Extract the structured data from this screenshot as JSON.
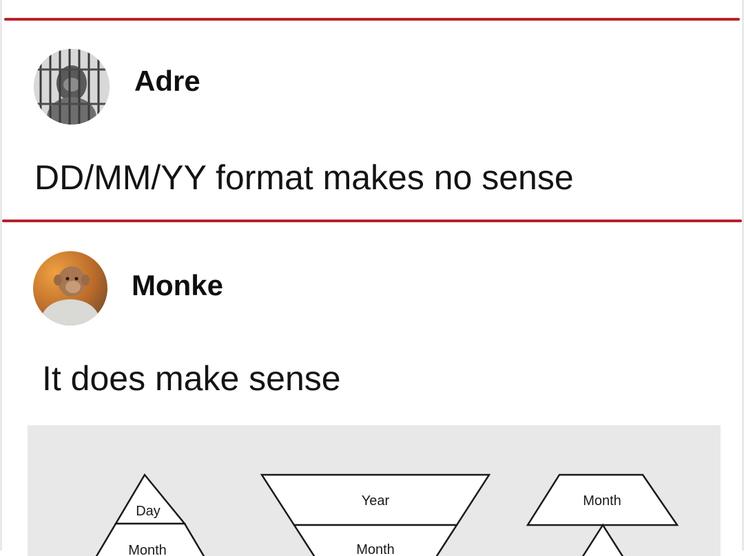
{
  "posts": [
    {
      "username": "Adre",
      "text": "DD/MM/YY format makes no sense"
    },
    {
      "username": "Monke",
      "text": "It does make sense",
      "diagram": {
        "left_pyramid": {
          "top_label": "Day",
          "middle_label": "Month"
        },
        "center_inverted": {
          "top_label": "Year",
          "middle_label": "Month"
        },
        "right_shape": {
          "top_label": "Month"
        }
      }
    }
  ],
  "colors": {
    "divider": "#b8222a",
    "background": "#ffffff",
    "diagram_background": "#e8e8e8"
  }
}
